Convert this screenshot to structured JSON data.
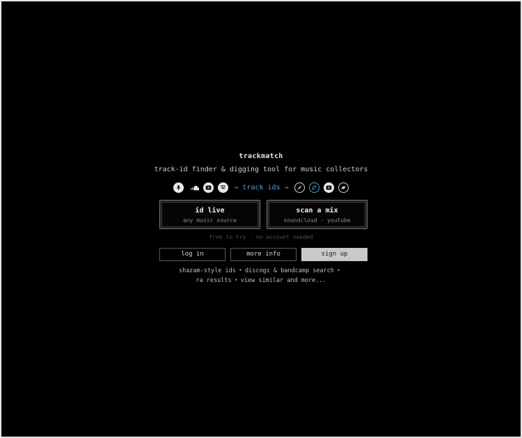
{
  "app": {
    "title": "trackmatch",
    "tagline": "track-id finder & digging tool for music collectors"
  },
  "flow": {
    "sources": [
      "microphone-icon",
      "soundcloud-icon",
      "youtube-icon",
      "spotify-icon"
    ],
    "label": "→ track ids →",
    "destinations": [
      "vinyl-icon",
      "discogs-icon",
      "youtube-icon",
      "bandcamp-icon"
    ],
    "accent_color": "#4aa3d8"
  },
  "cards": {
    "id_live": {
      "title": "id live",
      "subtitle": "any music source"
    },
    "scan_mix": {
      "title": "scan a mix",
      "subtitle": "soundcloud · youtube"
    }
  },
  "free_note": "free to try · no account needed",
  "buttons": {
    "login": "log in",
    "more_info": "more info",
    "sign_up": "sign up"
  },
  "features": {
    "f1": "shazam-style ids",
    "f2": "discogs & bandcamp search",
    "f3": "ra results",
    "f4": "view similar and more...",
    "bullet": "•"
  }
}
